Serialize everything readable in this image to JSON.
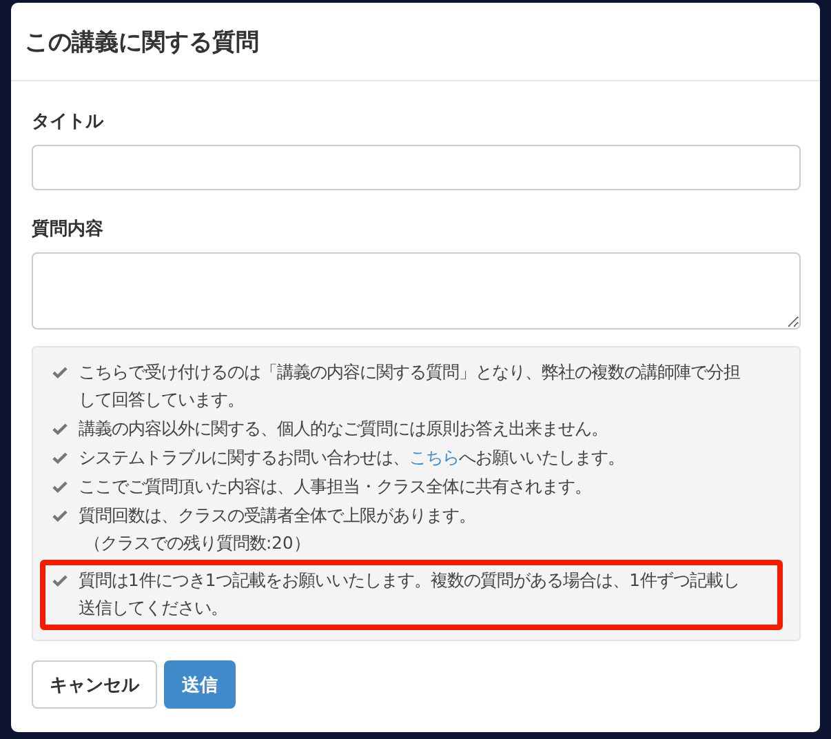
{
  "dialog": {
    "title": "この講義に関する質問"
  },
  "fields": [
    {
      "label": "タイトル",
      "kind": "input"
    },
    {
      "label": "質問内容",
      "kind": "textarea"
    }
  ],
  "notes": [
    {
      "text": "こちらで受け付けるのは「講義の内容に関する質問」となり、弊社の複数の講師陣で分担して回答しています。",
      "highlighted": false
    },
    {
      "text": "講義の内容以外に関する、個人的なご質問には原則お答え出来ません。",
      "highlighted": false
    },
    {
      "text": "システムトラブルに関するお問い合わせは、",
      "link": "こちら",
      "text_after": "へお願いいたします。",
      "highlighted": false
    },
    {
      "text": "ここでご質問頂いた内容は、人事担当・クラス全体に共有されます。",
      "highlighted": false
    },
    {
      "text": "質問回数は、クラスの受講者全体で上限があります。",
      "note": "（クラスでの残り質問数:20）",
      "highlighted": false
    },
    {
      "text": "質問は1件につき1つ記載をお願いいたします。複数の質問がある場合は、1件ずつ記載し送信してください。",
      "highlighted": true
    }
  ],
  "buttons": [
    {
      "label": "キャンセル",
      "kind": "default"
    },
    {
      "label": "送信",
      "kind": "primary"
    }
  ]
}
